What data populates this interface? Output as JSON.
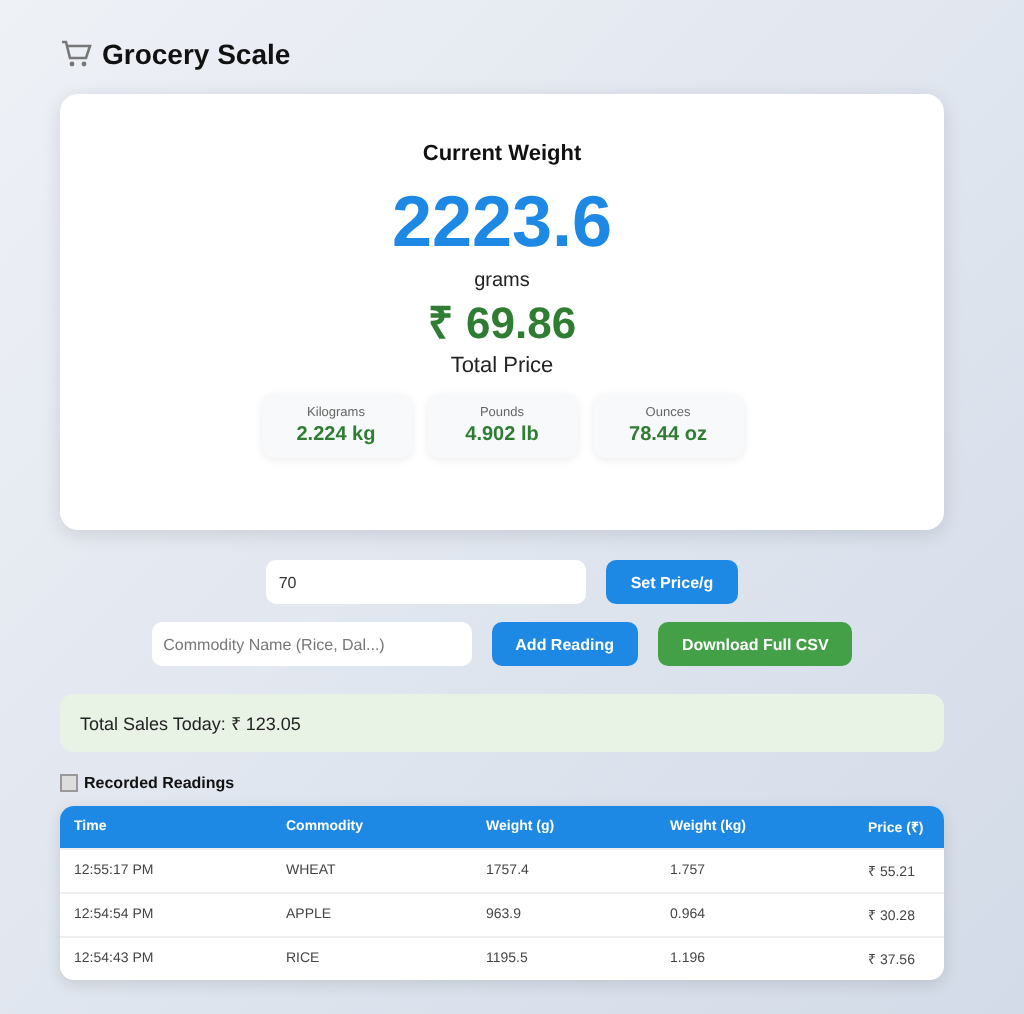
{
  "title": "Grocery Scale",
  "scale": {
    "heading": "Current Weight",
    "weight": "2223.6",
    "unit": "grams",
    "price": "₹ 69.86",
    "price_label": "Total Price",
    "conversions": [
      {
        "label": "Kilograms",
        "value": "2.224 kg"
      },
      {
        "label": "Pounds",
        "value": "4.902 lb"
      },
      {
        "label": "Ounces",
        "value": "78.44 oz"
      }
    ]
  },
  "price_field": {
    "value": "70"
  },
  "set_price_button": "Set Price/g",
  "commodity_field": {
    "placeholder": "Commodity Name (Rice, Dal...)"
  },
  "add_button": "Add Reading",
  "download_button": "Download Full CSV",
  "total_sales": "Total Sales Today: ₹ 123.05",
  "readings_title": "Recorded Readings",
  "table": {
    "columns": [
      "Time",
      "Commodity",
      "Weight (g)",
      "Weight (kg)",
      "Price (₹)"
    ],
    "rows": [
      [
        "12:55:17 PM",
        "WHEAT",
        "1757.4",
        "1.757",
        "₹ 55.21"
      ],
      [
        "12:54:54 PM",
        "APPLE",
        "963.9",
        "0.964",
        "₹ 30.28"
      ],
      [
        "12:54:43 PM",
        "RICE",
        "1195.5",
        "1.196",
        "₹ 37.56"
      ]
    ]
  }
}
